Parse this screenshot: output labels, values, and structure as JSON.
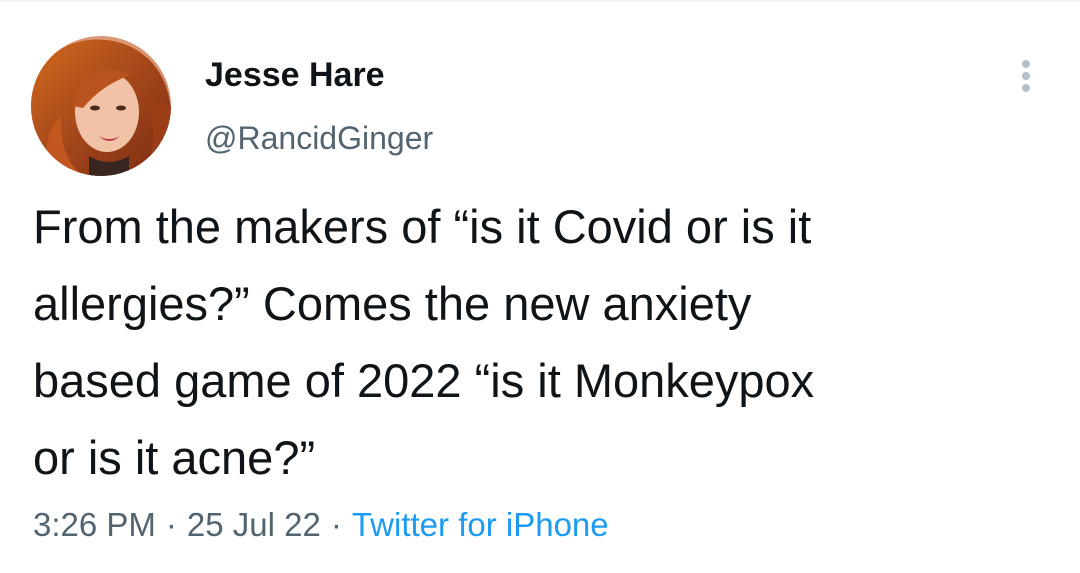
{
  "author": {
    "display_name": "Jesse Hare",
    "handle": "@RancidGinger",
    "avatar_icon": "profile-photo"
  },
  "tweet": {
    "text": "From the makers of “is it Covid or is it\nallergies?” Comes the new anxiety\nbased game of 2022 “is it Monkeypox\nor is it acne?”"
  },
  "meta": {
    "time": "3:26 PM",
    "separator": "·",
    "date": "25 Jul 22",
    "source": "Twitter for iPhone"
  },
  "actions": {
    "more_icon": "more-vertical-icon"
  },
  "colors": {
    "text_primary": "#0f1419",
    "text_secondary": "#536471",
    "link": "#1d9bf0",
    "divider": "#eff3f4"
  }
}
